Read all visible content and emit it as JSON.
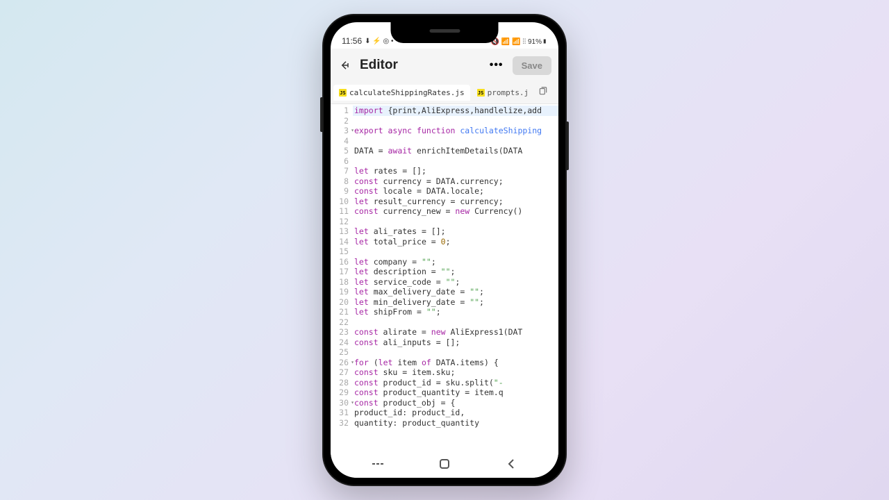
{
  "status": {
    "time": "11:56",
    "left_icons": "⬇ ⚡ ◎ •",
    "right_icons": "🔇 📶 📶 ⫶⫶ 91%▮"
  },
  "header": {
    "title": "Editor",
    "more": "•••",
    "save": "Save"
  },
  "tabs": [
    {
      "label": "calculateShippingRates.js",
      "active": true
    },
    {
      "label": "prompts.j",
      "active": false
    }
  ],
  "code": {
    "lines": [
      {
        "n": 1,
        "hl": true,
        "fold": "",
        "tokens": [
          [
            "kw",
            "import"
          ],
          [
            "def",
            " {print,AliExpress,handlelize,add"
          ]
        ]
      },
      {
        "n": 2,
        "hl": false,
        "fold": "",
        "tokens": []
      },
      {
        "n": 3,
        "hl": false,
        "fold": "▾",
        "tokens": [
          [
            "kw",
            "export"
          ],
          [
            "def",
            " "
          ],
          [
            "kw",
            "async"
          ],
          [
            "def",
            " "
          ],
          [
            "kw",
            "function"
          ],
          [
            "def",
            " "
          ],
          [
            "fn",
            "calculateShipping"
          ]
        ]
      },
      {
        "n": 4,
        "hl": false,
        "fold": "",
        "tokens": []
      },
      {
        "n": 5,
        "hl": false,
        "fold": "",
        "tokens": [
          [
            "def",
            "    DATA = "
          ],
          [
            "kw",
            "await"
          ],
          [
            "def",
            " enrichItemDetails(DATA"
          ]
        ]
      },
      {
        "n": 6,
        "hl": false,
        "fold": "",
        "tokens": []
      },
      {
        "n": 7,
        "hl": false,
        "fold": "",
        "tokens": [
          [
            "def",
            "    "
          ],
          [
            "kw",
            "let"
          ],
          [
            "def",
            " rates = [];"
          ]
        ]
      },
      {
        "n": 8,
        "hl": false,
        "fold": "",
        "tokens": [
          [
            "def",
            "    "
          ],
          [
            "kw",
            "const"
          ],
          [
            "def",
            " currency = DATA.currency;"
          ]
        ]
      },
      {
        "n": 9,
        "hl": false,
        "fold": "",
        "tokens": [
          [
            "def",
            "    "
          ],
          [
            "kw",
            "const"
          ],
          [
            "def",
            " locale = DATA.locale;"
          ]
        ]
      },
      {
        "n": 10,
        "hl": false,
        "fold": "",
        "tokens": [
          [
            "def",
            "    "
          ],
          [
            "kw",
            "let"
          ],
          [
            "def",
            " result_currency = currency;"
          ]
        ]
      },
      {
        "n": 11,
        "hl": false,
        "fold": "",
        "tokens": [
          [
            "def",
            "    "
          ],
          [
            "kw",
            "const"
          ],
          [
            "def",
            " currency_new = "
          ],
          [
            "kw",
            "new"
          ],
          [
            "def",
            " Currency()"
          ]
        ]
      },
      {
        "n": 12,
        "hl": false,
        "fold": "",
        "tokens": []
      },
      {
        "n": 13,
        "hl": false,
        "fold": "",
        "tokens": [
          [
            "def",
            "    "
          ],
          [
            "kw",
            "let"
          ],
          [
            "def",
            " ali_rates = [];"
          ]
        ]
      },
      {
        "n": 14,
        "hl": false,
        "fold": "",
        "tokens": [
          [
            "def",
            "    "
          ],
          [
            "kw",
            "let"
          ],
          [
            "def",
            " total_price = "
          ],
          [
            "num",
            "0"
          ],
          [
            "def",
            ";"
          ]
        ]
      },
      {
        "n": 15,
        "hl": false,
        "fold": "",
        "tokens": []
      },
      {
        "n": 16,
        "hl": false,
        "fold": "",
        "tokens": [
          [
            "def",
            "    "
          ],
          [
            "kw",
            "let"
          ],
          [
            "def",
            " company = "
          ],
          [
            "str",
            "\"\""
          ],
          [
            "def",
            ";"
          ]
        ]
      },
      {
        "n": 17,
        "hl": false,
        "fold": "",
        "tokens": [
          [
            "def",
            "    "
          ],
          [
            "kw",
            "let"
          ],
          [
            "def",
            " description = "
          ],
          [
            "str",
            "\"\""
          ],
          [
            "def",
            ";"
          ]
        ]
      },
      {
        "n": 18,
        "hl": false,
        "fold": "",
        "tokens": [
          [
            "def",
            "    "
          ],
          [
            "kw",
            "let"
          ],
          [
            "def",
            " service_code = "
          ],
          [
            "str",
            "\"\""
          ],
          [
            "def",
            ";"
          ]
        ]
      },
      {
        "n": 19,
        "hl": false,
        "fold": "",
        "tokens": [
          [
            "def",
            "    "
          ],
          [
            "kw",
            "let"
          ],
          [
            "def",
            " max_delivery_date = "
          ],
          [
            "str",
            "\"\""
          ],
          [
            "def",
            ";"
          ]
        ]
      },
      {
        "n": 20,
        "hl": false,
        "fold": "",
        "tokens": [
          [
            "def",
            "    "
          ],
          [
            "kw",
            "let"
          ],
          [
            "def",
            " min_delivery_date = "
          ],
          [
            "str",
            "\"\""
          ],
          [
            "def",
            ";"
          ]
        ]
      },
      {
        "n": 21,
        "hl": false,
        "fold": "",
        "tokens": [
          [
            "def",
            "    "
          ],
          [
            "kw",
            "let"
          ],
          [
            "def",
            " shipFrom = "
          ],
          [
            "str",
            "\"\""
          ],
          [
            "def",
            ";"
          ]
        ]
      },
      {
        "n": 22,
        "hl": false,
        "fold": "",
        "tokens": []
      },
      {
        "n": 23,
        "hl": false,
        "fold": "",
        "tokens": [
          [
            "def",
            "    "
          ],
          [
            "kw",
            "const"
          ],
          [
            "def",
            " alirate = "
          ],
          [
            "kw",
            "new"
          ],
          [
            "def",
            " AliExpress1(DAT"
          ]
        ]
      },
      {
        "n": 24,
        "hl": false,
        "fold": "",
        "tokens": [
          [
            "def",
            "    "
          ],
          [
            "kw",
            "const"
          ],
          [
            "def",
            " ali_inputs = [];"
          ]
        ]
      },
      {
        "n": 25,
        "hl": false,
        "fold": "",
        "tokens": []
      },
      {
        "n": 26,
        "hl": false,
        "fold": "▾",
        "tokens": [
          [
            "def",
            "    "
          ],
          [
            "kw",
            "for"
          ],
          [
            "def",
            " ("
          ],
          [
            "kw",
            "let"
          ],
          [
            "def",
            " item "
          ],
          [
            "kw",
            "of"
          ],
          [
            "def",
            " DATA.items) {"
          ]
        ]
      },
      {
        "n": 27,
        "hl": false,
        "fold": "",
        "tokens": [
          [
            "def",
            "        "
          ],
          [
            "kw",
            "const"
          ],
          [
            "def",
            " sku = item.sku;"
          ]
        ]
      },
      {
        "n": 28,
        "hl": false,
        "fold": "",
        "tokens": [
          [
            "def",
            "        "
          ],
          [
            "kw",
            "const"
          ],
          [
            "def",
            " product_id = sku.split("
          ],
          [
            "str",
            "\"-"
          ]
        ]
      },
      {
        "n": 29,
        "hl": false,
        "fold": "",
        "tokens": [
          [
            "def",
            "        "
          ],
          [
            "kw",
            "const"
          ],
          [
            "def",
            " product_quantity = item.q"
          ]
        ]
      },
      {
        "n": 30,
        "hl": false,
        "fold": "▾",
        "tokens": [
          [
            "def",
            "        "
          ],
          [
            "kw",
            "const"
          ],
          [
            "def",
            " product_obj = {"
          ]
        ]
      },
      {
        "n": 31,
        "hl": false,
        "fold": "",
        "tokens": [
          [
            "def",
            "            product_id: product_id,"
          ]
        ]
      },
      {
        "n": 32,
        "hl": false,
        "fold": "",
        "tokens": [
          [
            "def",
            "            quantity: product_quantity"
          ]
        ]
      }
    ]
  }
}
